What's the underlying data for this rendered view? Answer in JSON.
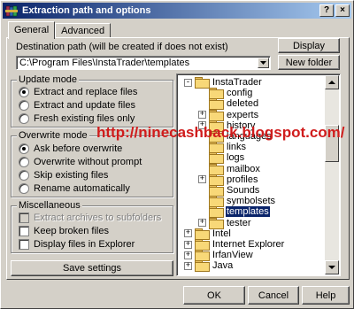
{
  "window": {
    "title": "Extraction path and options",
    "help_glyph": "?",
    "close_glyph": "×"
  },
  "tabs": [
    {
      "label": "General",
      "active": true
    },
    {
      "label": "Advanced",
      "active": false
    }
  ],
  "destination": {
    "label": "Destination path (will be created if does not exist)",
    "value": "C:\\Program Files\\InstaTrader\\templates",
    "display_button": "Display",
    "new_folder_button": "New folder"
  },
  "update_mode": {
    "title": "Update mode",
    "options": [
      {
        "label": "Extract and replace files",
        "selected": true
      },
      {
        "label": "Extract and update files",
        "selected": false
      },
      {
        "label": "Fresh existing files only",
        "selected": false
      }
    ]
  },
  "overwrite_mode": {
    "title": "Overwrite mode",
    "options": [
      {
        "label": "Ask before overwrite",
        "selected": true
      },
      {
        "label": "Overwrite without prompt",
        "selected": false
      },
      {
        "label": "Skip existing files",
        "selected": false
      },
      {
        "label": "Rename automatically",
        "selected": false
      }
    ]
  },
  "miscellaneous": {
    "title": "Miscellaneous",
    "options": [
      {
        "label": "Extract archives to subfolders",
        "checked": false,
        "disabled": true
      },
      {
        "label": "Keep broken files",
        "checked": false,
        "disabled": false
      },
      {
        "label": "Display files in Explorer",
        "checked": false,
        "disabled": false
      }
    ]
  },
  "save_settings_button": "Save settings",
  "tree": {
    "rows": [
      {
        "label": "InstaTrader",
        "expander": "-",
        "selected": false
      },
      {
        "label": "config",
        "expander": "",
        "selected": false
      },
      {
        "label": "deleted",
        "expander": "",
        "selected": false
      },
      {
        "label": "experts",
        "expander": "+",
        "selected": false
      },
      {
        "label": "history",
        "expander": "+",
        "selected": false
      },
      {
        "label": "languages",
        "expander": "",
        "selected": false
      },
      {
        "label": "links",
        "expander": "",
        "selected": false
      },
      {
        "label": "logs",
        "expander": "",
        "selected": false
      },
      {
        "label": "mailbox",
        "expander": "",
        "selected": false
      },
      {
        "label": "profiles",
        "expander": "+",
        "selected": false
      },
      {
        "label": "Sounds",
        "expander": "",
        "selected": false
      },
      {
        "label": "symbolsets",
        "expander": "",
        "selected": false
      },
      {
        "label": "templates",
        "expander": "",
        "selected": true
      },
      {
        "label": "tester",
        "expander": "+",
        "selected": false
      },
      {
        "label": "Intel",
        "expander": "+",
        "selected": false
      },
      {
        "label": "Internet Explorer",
        "expander": "+",
        "selected": false
      },
      {
        "label": "IrfanView",
        "expander": "+",
        "selected": false
      },
      {
        "label": "Java",
        "expander": "+",
        "selected": false
      }
    ]
  },
  "footer": {
    "ok": "OK",
    "cancel": "Cancel",
    "help": "Help"
  },
  "watermark": "http://ninecashback.blogspot.com/",
  "colors": {
    "title_bar_start": "#0a246a",
    "title_bar_end": "#a6caf0",
    "selection": "#0a246a",
    "watermark": "#d01c1c",
    "face": "#d4d0c8"
  }
}
